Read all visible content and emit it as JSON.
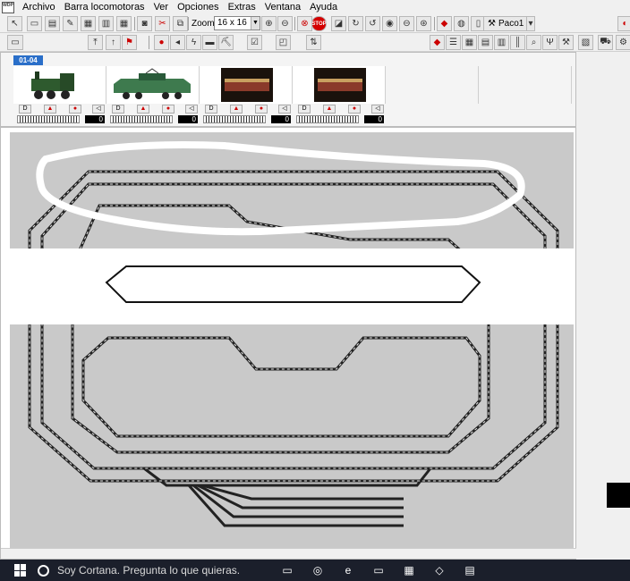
{
  "app": {
    "icon_text": "WDP"
  },
  "menu": [
    {
      "label": "Archivo"
    },
    {
      "label": "Barra locomotoras"
    },
    {
      "label": "Ver"
    },
    {
      "label": "Opciones"
    },
    {
      "label": "Extras"
    },
    {
      "label": "Ventana"
    },
    {
      "label": "Ayuda"
    }
  ],
  "toolbar": {
    "zoom_label": "Zoom",
    "zoom_value": "16 x 16",
    "stop_text": "STOP",
    "user_button": "Paco1"
  },
  "locos": {
    "tab_label": "01-04",
    "slots": [
      {
        "speed": "0",
        "name": "steam-loco",
        "color": "#2e5a2e"
      },
      {
        "speed": "0",
        "name": "electric-loco",
        "color": "#3e7a4e"
      },
      {
        "speed": "0",
        "name": "diesel-loco",
        "color": "#8a3a2a"
      },
      {
        "speed": "0",
        "name": "diesel-loco",
        "color": "#8a3a2a"
      }
    ]
  },
  "taskbar": {
    "cortana_placeholder": "Soy Cortana. Pregunta lo que quieras."
  }
}
